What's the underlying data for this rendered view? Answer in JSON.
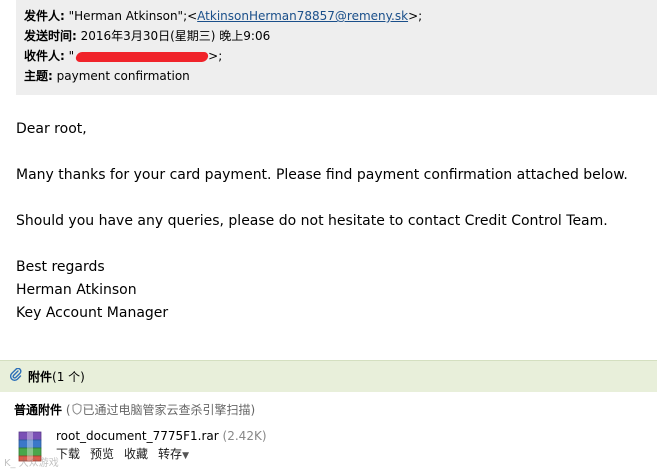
{
  "header": {
    "from_label": "发件人:",
    "from_name": "\"Herman Atkinson\";<",
    "from_email": "AtkinsonHerman78857@remeny.sk",
    "from_suffix": ">;",
    "date_label": "发送时间:",
    "date_value": "2016年3月30日(星期三) 晚上9:06",
    "to_label": "收件人:",
    "to_prefix": "\"",
    "to_suffix": ">;",
    "subject_label": "主题:",
    "subject_value": "payment confirmation"
  },
  "body": {
    "greeting": "Dear root,",
    "line1": "Many thanks for your card payment. Please find payment confirmation attached below.",
    "line2": "Should you have any queries, please do not hesitate to contact Credit Control Team.",
    "closing": "Best regards",
    "sender_name": "Herman Atkinson",
    "sender_title": "Key Account Manager"
  },
  "attachments": {
    "title": "附件",
    "count": "(1 个)",
    "section_title": "普通附件",
    "scan_prefix": "(",
    "scan_text": "已通过电脑管家云查杀引擎扫描)",
    "file_name": "root_document_7775F1.rar",
    "file_size": "(2.42K)",
    "actions": [
      "下载",
      "预览",
      "收藏",
      "转存"
    ]
  },
  "watermark": "K_ 大众游戏"
}
